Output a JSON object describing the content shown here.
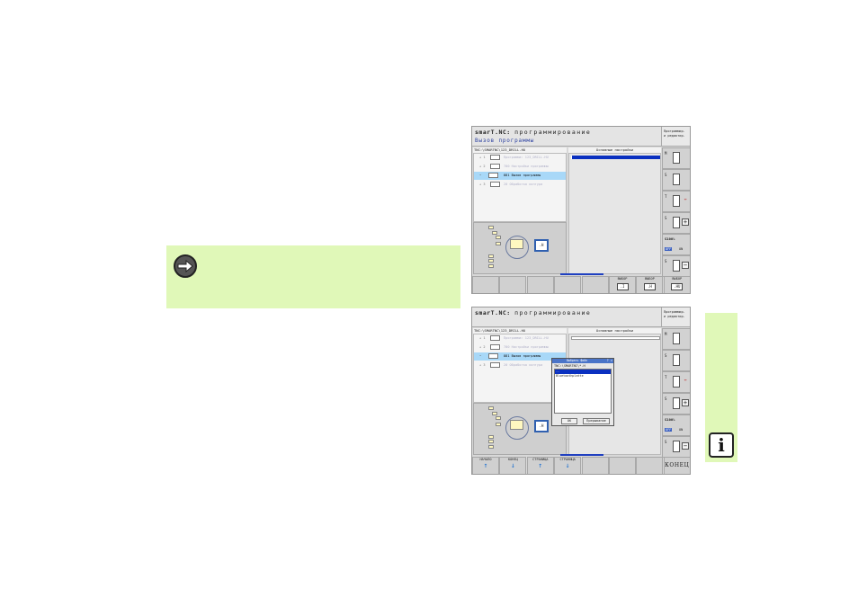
{
  "note": {
    "icon": "arrow-right-icon",
    "color": "#e0f8b8"
  },
  "side_strip": {
    "icon": "info-icon",
    "icon_text": "i"
  },
  "screen1": {
    "title": "smarT.NC:",
    "title_suffix": "программирование",
    "mode": "Вызов программы",
    "top_right": [
      "Программир.",
      "и редактир."
    ],
    "path": "TNC:\\SMARTNC\\123_DRILL.HU",
    "form_header": "Основные настройки",
    "tree_rows": [
      {
        "bullet": "+ 1",
        "text": "Программа: 123_DRILL.HU",
        "selected": false
      },
      {
        "bullet": "+ 2",
        "text": "700 Настройки программы",
        "selected": false
      },
      {
        "bullet": "•",
        "text": "881 Вызов программы",
        "selected": true
      },
      {
        "bullet": "+ 3",
        "text": "20 Обработка контура",
        "selected": false
      }
    ],
    "doc_label": ".H",
    "vsoftkeys": [
      {
        "label": "M",
        "kind": "pic"
      },
      {
        "label": "S",
        "kind": "pic"
      },
      {
        "label": "T",
        "kind": "arrows"
      },
      {
        "label": "S",
        "kind": "plus",
        "sign": "+"
      },
      {
        "label": "S100%",
        "kind": "onoff",
        "off": "OFF",
        "on": "ON"
      },
      {
        "label": "S",
        "kind": "minus",
        "sign": "−"
      }
    ],
    "hsoftkeys": [
      {
        "label": "",
        "kind": "blank"
      },
      {
        "label": "",
        "kind": "blank"
      },
      {
        "label": "",
        "kind": "blank"
      },
      {
        "label": "",
        "kind": "blank"
      },
      {
        "label": "",
        "kind": "blank"
      },
      {
        "label": "ВЫБОР",
        "kind": "box",
        "box": ".I"
      },
      {
        "label": "ВЫБОР",
        "kind": "box",
        "box": ".H"
      },
      {
        "label": "ВЫБОР",
        "kind": "box",
        "box": ".HU"
      }
    ]
  },
  "screen2": {
    "title": "smarT.NC:",
    "title_suffix": "программирование",
    "top_right": [
      "Программир.",
      "и редактир."
    ],
    "path": "TNC:\\SMARTNC\\123_DRILL.HU",
    "form_header": "Основные настройки",
    "tree_rows": [
      {
        "bullet": "+ 1",
        "text": "Программа: 123_DRILL.HU",
        "selected": false
      },
      {
        "bullet": "+ 2",
        "text": "700 Настройки программы",
        "selected": false
      },
      {
        "bullet": "•",
        "text": "881 Вызов программы",
        "selected": true
      },
      {
        "bullet": "+ 3",
        "text": "20 Обработка контура",
        "selected": false
      }
    ],
    "doc_label": ".H",
    "dialog": {
      "title": "Выбрать файл",
      "close": "? ×",
      "path": "TNC:\\SMARTNC\\*.H",
      "files": [
        "..",
        "Bluetoothplatte"
      ],
      "ok": "OK",
      "cancel": "Прерывание"
    },
    "vsoftkeys": [
      {
        "label": "M",
        "kind": "pic"
      },
      {
        "label": "S",
        "kind": "pic"
      },
      {
        "label": "T",
        "kind": "arrows"
      },
      {
        "label": "S",
        "kind": "plus",
        "sign": "+"
      },
      {
        "label": "S100%",
        "kind": "onoff",
        "off": "OFF",
        "on": "ON"
      },
      {
        "label": "S",
        "kind": "minus",
        "sign": "−"
      }
    ],
    "hsoftkeys": [
      {
        "label": "НАЧАЛО",
        "kind": "up"
      },
      {
        "label": "КОНЕЦ",
        "kind": "down"
      },
      {
        "label": "СТРАНИЦА",
        "kind": "up"
      },
      {
        "label": "СТРАНИЦА",
        "kind": "down"
      },
      {
        "label": "",
        "kind": "blank"
      },
      {
        "label": "",
        "kind": "blank"
      },
      {
        "label": "",
        "kind": "blank"
      },
      {
        "label": "КОНЕЦ",
        "kind": "end"
      }
    ]
  }
}
